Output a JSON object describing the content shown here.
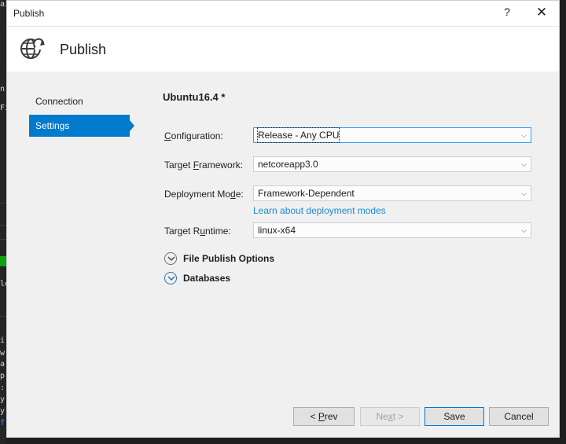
{
  "window": {
    "title": "Publish",
    "help_glyph": "?",
    "close_glyph": "✕"
  },
  "header": {
    "title": "Publish",
    "icon": "globe-publish-icon"
  },
  "nav": {
    "items": [
      {
        "label": "Connection",
        "active": false
      },
      {
        "label": "Settings",
        "active": true
      }
    ]
  },
  "profile": {
    "name": "Ubuntu16.4 *"
  },
  "settings": {
    "configuration": {
      "label_pre": "",
      "label_key": "C",
      "label_post": "onfiguration:",
      "value": "Release - Any CPU"
    },
    "framework": {
      "label_pre": "Target ",
      "label_key": "F",
      "label_post": "ramework:",
      "value": "netcoreapp3.0"
    },
    "deployment": {
      "label_pre": "Deployment Mo",
      "label_key": "d",
      "label_post": "e:",
      "value": "Framework-Dependent"
    },
    "runtime": {
      "label_pre": "Target R",
      "label_key": "u",
      "label_post": "ntime:",
      "value": "linux-x64"
    },
    "deployment_link": "Learn about deployment modes"
  },
  "sections": {
    "file_publish": "File Publish Options",
    "databases": "Databases"
  },
  "buttons": {
    "prev_pre": "< ",
    "prev_key": "P",
    "prev_post": "rev",
    "next_pre": "Ne",
    "next_key": "x",
    "next_post": "t >",
    "save": "Save",
    "cancel": "Cancel"
  },
  "colors": {
    "accent": "#007acc",
    "link": "#1a8ad4",
    "dialog_bg": "#f0f0f0"
  },
  "background_glyphs": [
    "ai",
    "n",
    "Fi",
    "le",
    "i",
    "w",
    "a",
    "p",
    ":",
    "y",
    "y",
    "f"
  ]
}
